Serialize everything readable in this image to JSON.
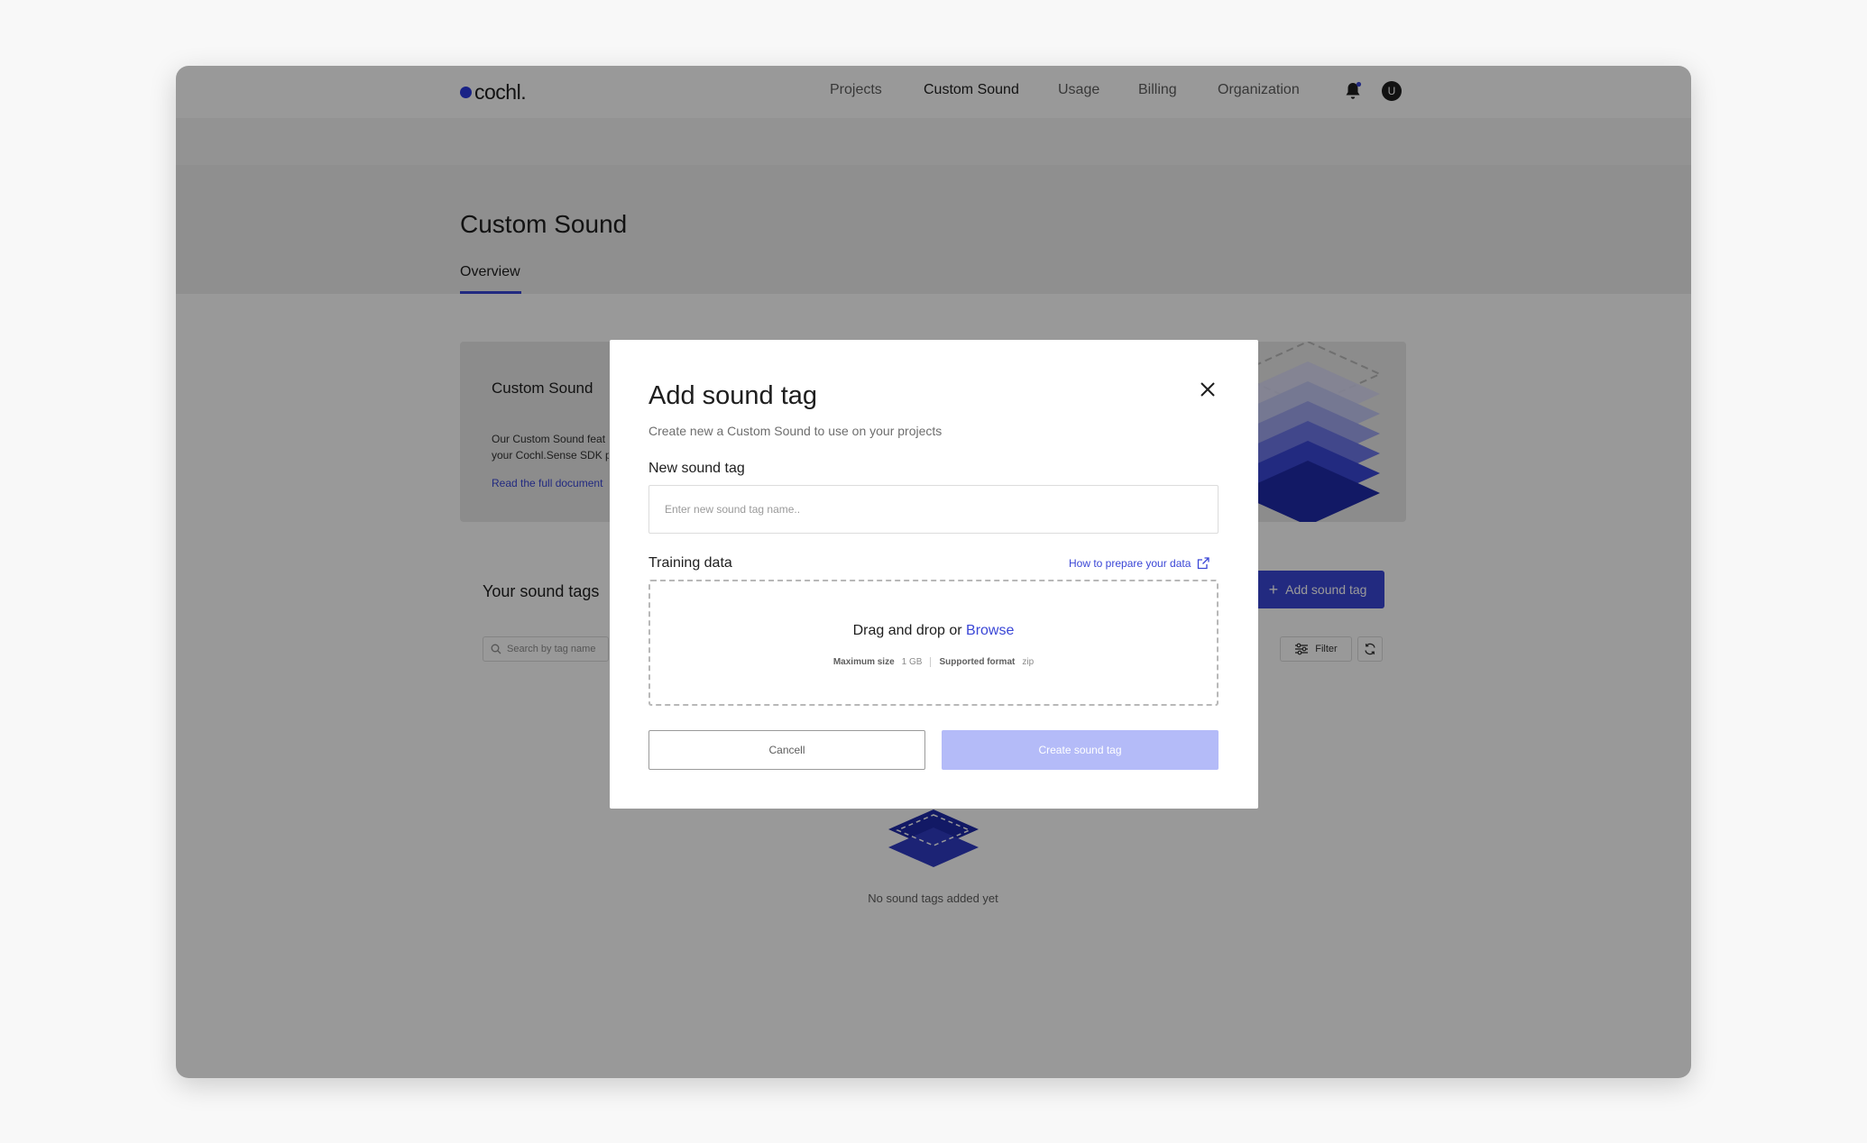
{
  "app": {
    "logo_text": "cochl."
  },
  "nav": {
    "items": [
      {
        "label": "Projects"
      },
      {
        "label": "Custom Sound"
      },
      {
        "label": "Usage"
      },
      {
        "label": "Billing"
      },
      {
        "label": "Organization"
      }
    ],
    "active": "Custom Sound",
    "avatar_initial": "U"
  },
  "page": {
    "title": "Custom Sound",
    "tab": "Overview"
  },
  "hero": {
    "title": "Custom Sound",
    "desc_line1": "Our Custom Sound feat",
    "desc_line2": "your Cochl.Sense SDK p",
    "link": "Read the full document"
  },
  "list": {
    "title": "Your sound tags",
    "add_button": "Add sound tag",
    "search_placeholder": "Search by tag name",
    "filter_label": "Filter",
    "empty_text": "No sound tags added yet"
  },
  "modal": {
    "title": "Add sound tag",
    "subtitle": "Create new a Custom Sound to use on your projects",
    "field_label": "New sound tag",
    "field_placeholder": "Enter new sound tag name..",
    "training_label": "Training data",
    "prepare_link": "How to prepare your data",
    "drop_text": "Drag and drop or ",
    "browse": "Browse",
    "max_size_label": "Maximum size",
    "max_size_value": "1 GB",
    "format_label": "Supported format",
    "format_value": "zip",
    "cancel": "Cancell",
    "create": "Create sound tag"
  },
  "colors": {
    "accent": "#3a46d6",
    "accent_disabled": "#b4bbf8",
    "overlay": "rgba(0,0,0,0.4)"
  }
}
